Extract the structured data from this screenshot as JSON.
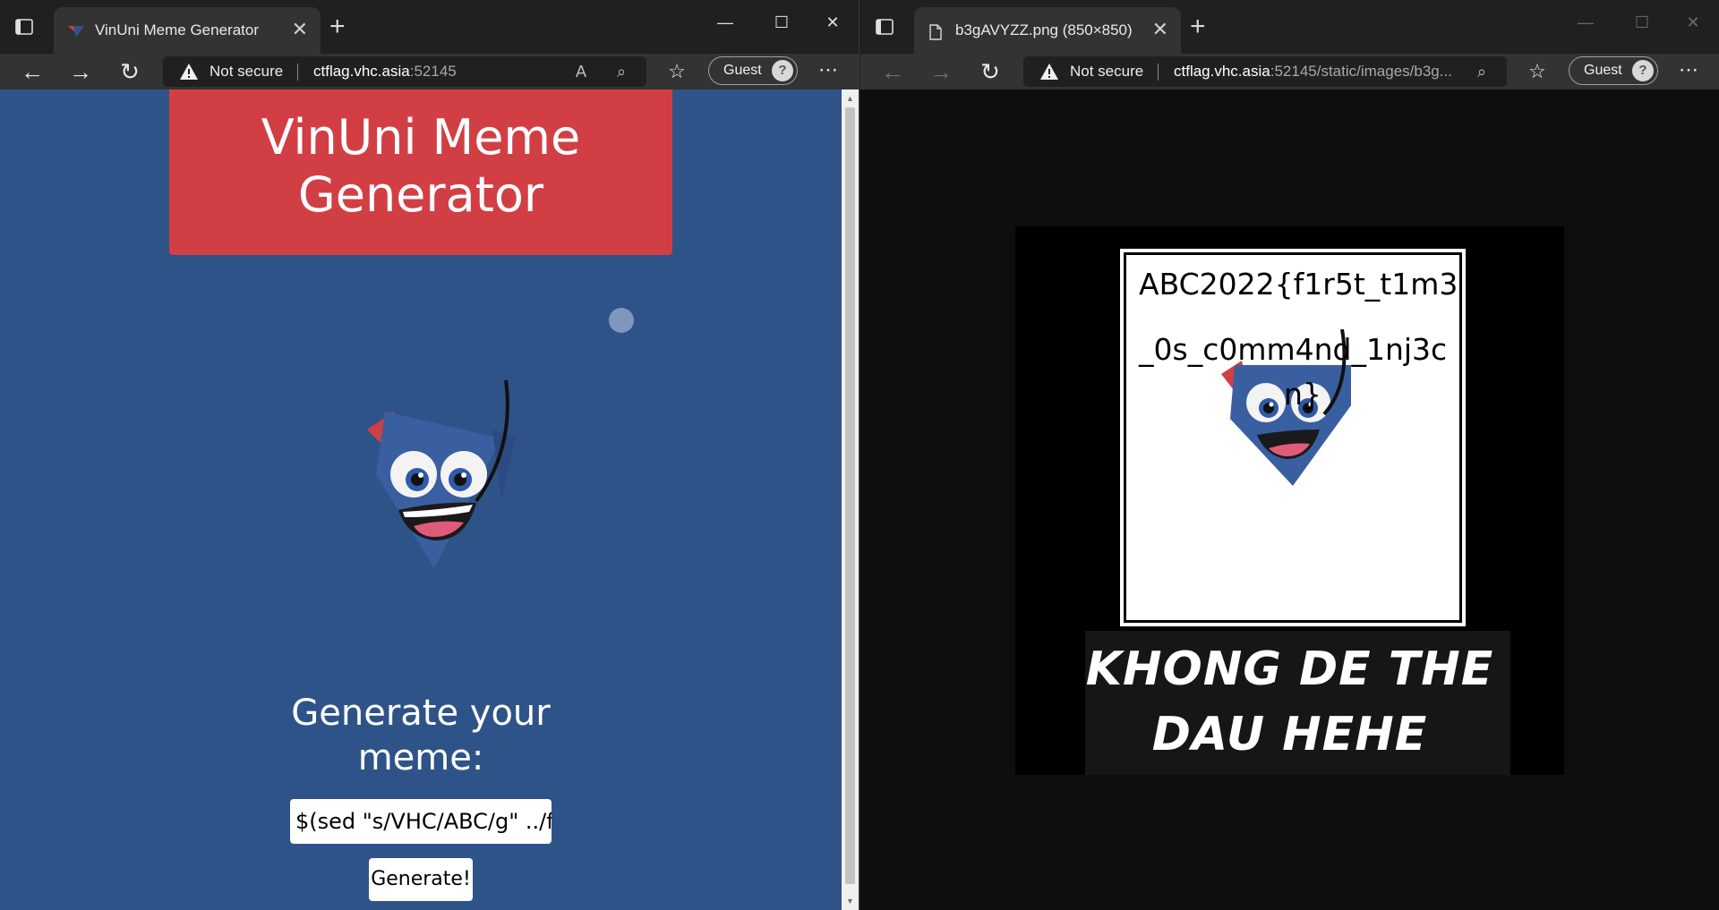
{
  "left_window": {
    "tab_title": "VinUni Meme Generator",
    "security_label": "Not secure",
    "url_host": "ctflag.vhc.asia",
    "url_rest": ":52145",
    "guest_label": "Guest",
    "page": {
      "hero_title": "VinUni Meme Generator",
      "generate_title": "Generate your meme:",
      "input_value": "$(sed \"s/VHC/ABC/g\" ../flag",
      "generate_button": "Generate!"
    }
  },
  "right_window": {
    "tab_title": "b3gAVYZZ.png (850×850)",
    "security_label": "Not secure",
    "url_host": "ctflag.vhc.asia",
    "url_rest": ":52145/static/images/b3g...",
    "guest_label": "Guest",
    "image": {
      "flag_line1": "ABC2022{f1r5t_t1m3",
      "flag_line2": "_0s_c0mm4nd_1nj3c",
      "flag_line3": "n}",
      "caption_line1": "KHONG DE THE",
      "caption_line2": "DAU HEHE"
    }
  },
  "colors": {
    "page_bg": "#2e5389",
    "hero_bg": "#d13f44",
    "viewer_bg": "#0e0e0e"
  },
  "icons": [
    "tab-actions-icon",
    "vinuni-favicon",
    "close-icon",
    "new-tab-icon",
    "minimize-icon",
    "maximize-icon",
    "window-close-icon",
    "back-icon",
    "forward-icon",
    "refresh-icon",
    "warning-icon",
    "read-aloud-icon",
    "zoom-icon",
    "favorites-icon",
    "guest-avatar-icon",
    "more-icon",
    "file-icon",
    "visual-search-icon"
  ]
}
